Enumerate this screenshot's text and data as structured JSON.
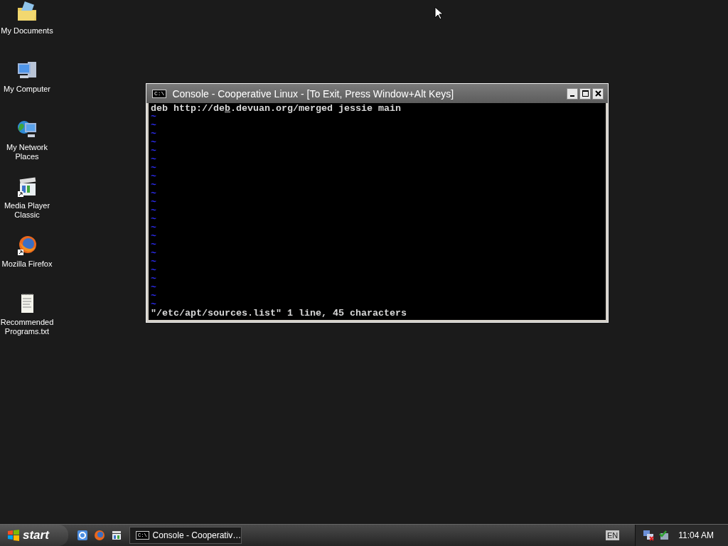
{
  "desktop_icons": [
    {
      "label": "My Documents",
      "kind": "folder"
    },
    {
      "label": "My Computer",
      "kind": "computer"
    },
    {
      "label": "My Network Places",
      "kind": "network"
    },
    {
      "label": "Media Player Classic",
      "kind": "media"
    },
    {
      "label": "Mozilla Firefox",
      "kind": "firefox"
    },
    {
      "label": "Recommended Programs.txt",
      "kind": "text"
    }
  ],
  "window": {
    "title": "Console - Cooperative Linux - [To Exit, Press Window+Alt Keys]",
    "icon_text": "C:\\",
    "buffer_line": {
      "before": "deb http://de",
      "cursor": "b",
      "after": ".devuan.org/merged jessie main"
    },
    "empty_lines": [
      "~",
      "~",
      "~",
      "~",
      "~",
      "~",
      "~",
      "~",
      "~",
      "~",
      "~",
      "~",
      "~",
      "~",
      "~",
      "~",
      "~",
      "~",
      "~",
      "~",
      "~",
      "~",
      "~"
    ],
    "status_line": "\"/etc/apt/sources.list\" 1 line, 45 characters"
  },
  "taskbar": {
    "start": "start",
    "quick_launch": [
      {
        "kind": "ie"
      },
      {
        "kind": "firefox"
      },
      {
        "kind": "media"
      }
    ],
    "tasks": [
      {
        "label": "Console - Cooperativ…",
        "icon_text": "C:\\",
        "selected": false
      }
    ],
    "language": "EN",
    "clock": "11:04 AM"
  }
}
